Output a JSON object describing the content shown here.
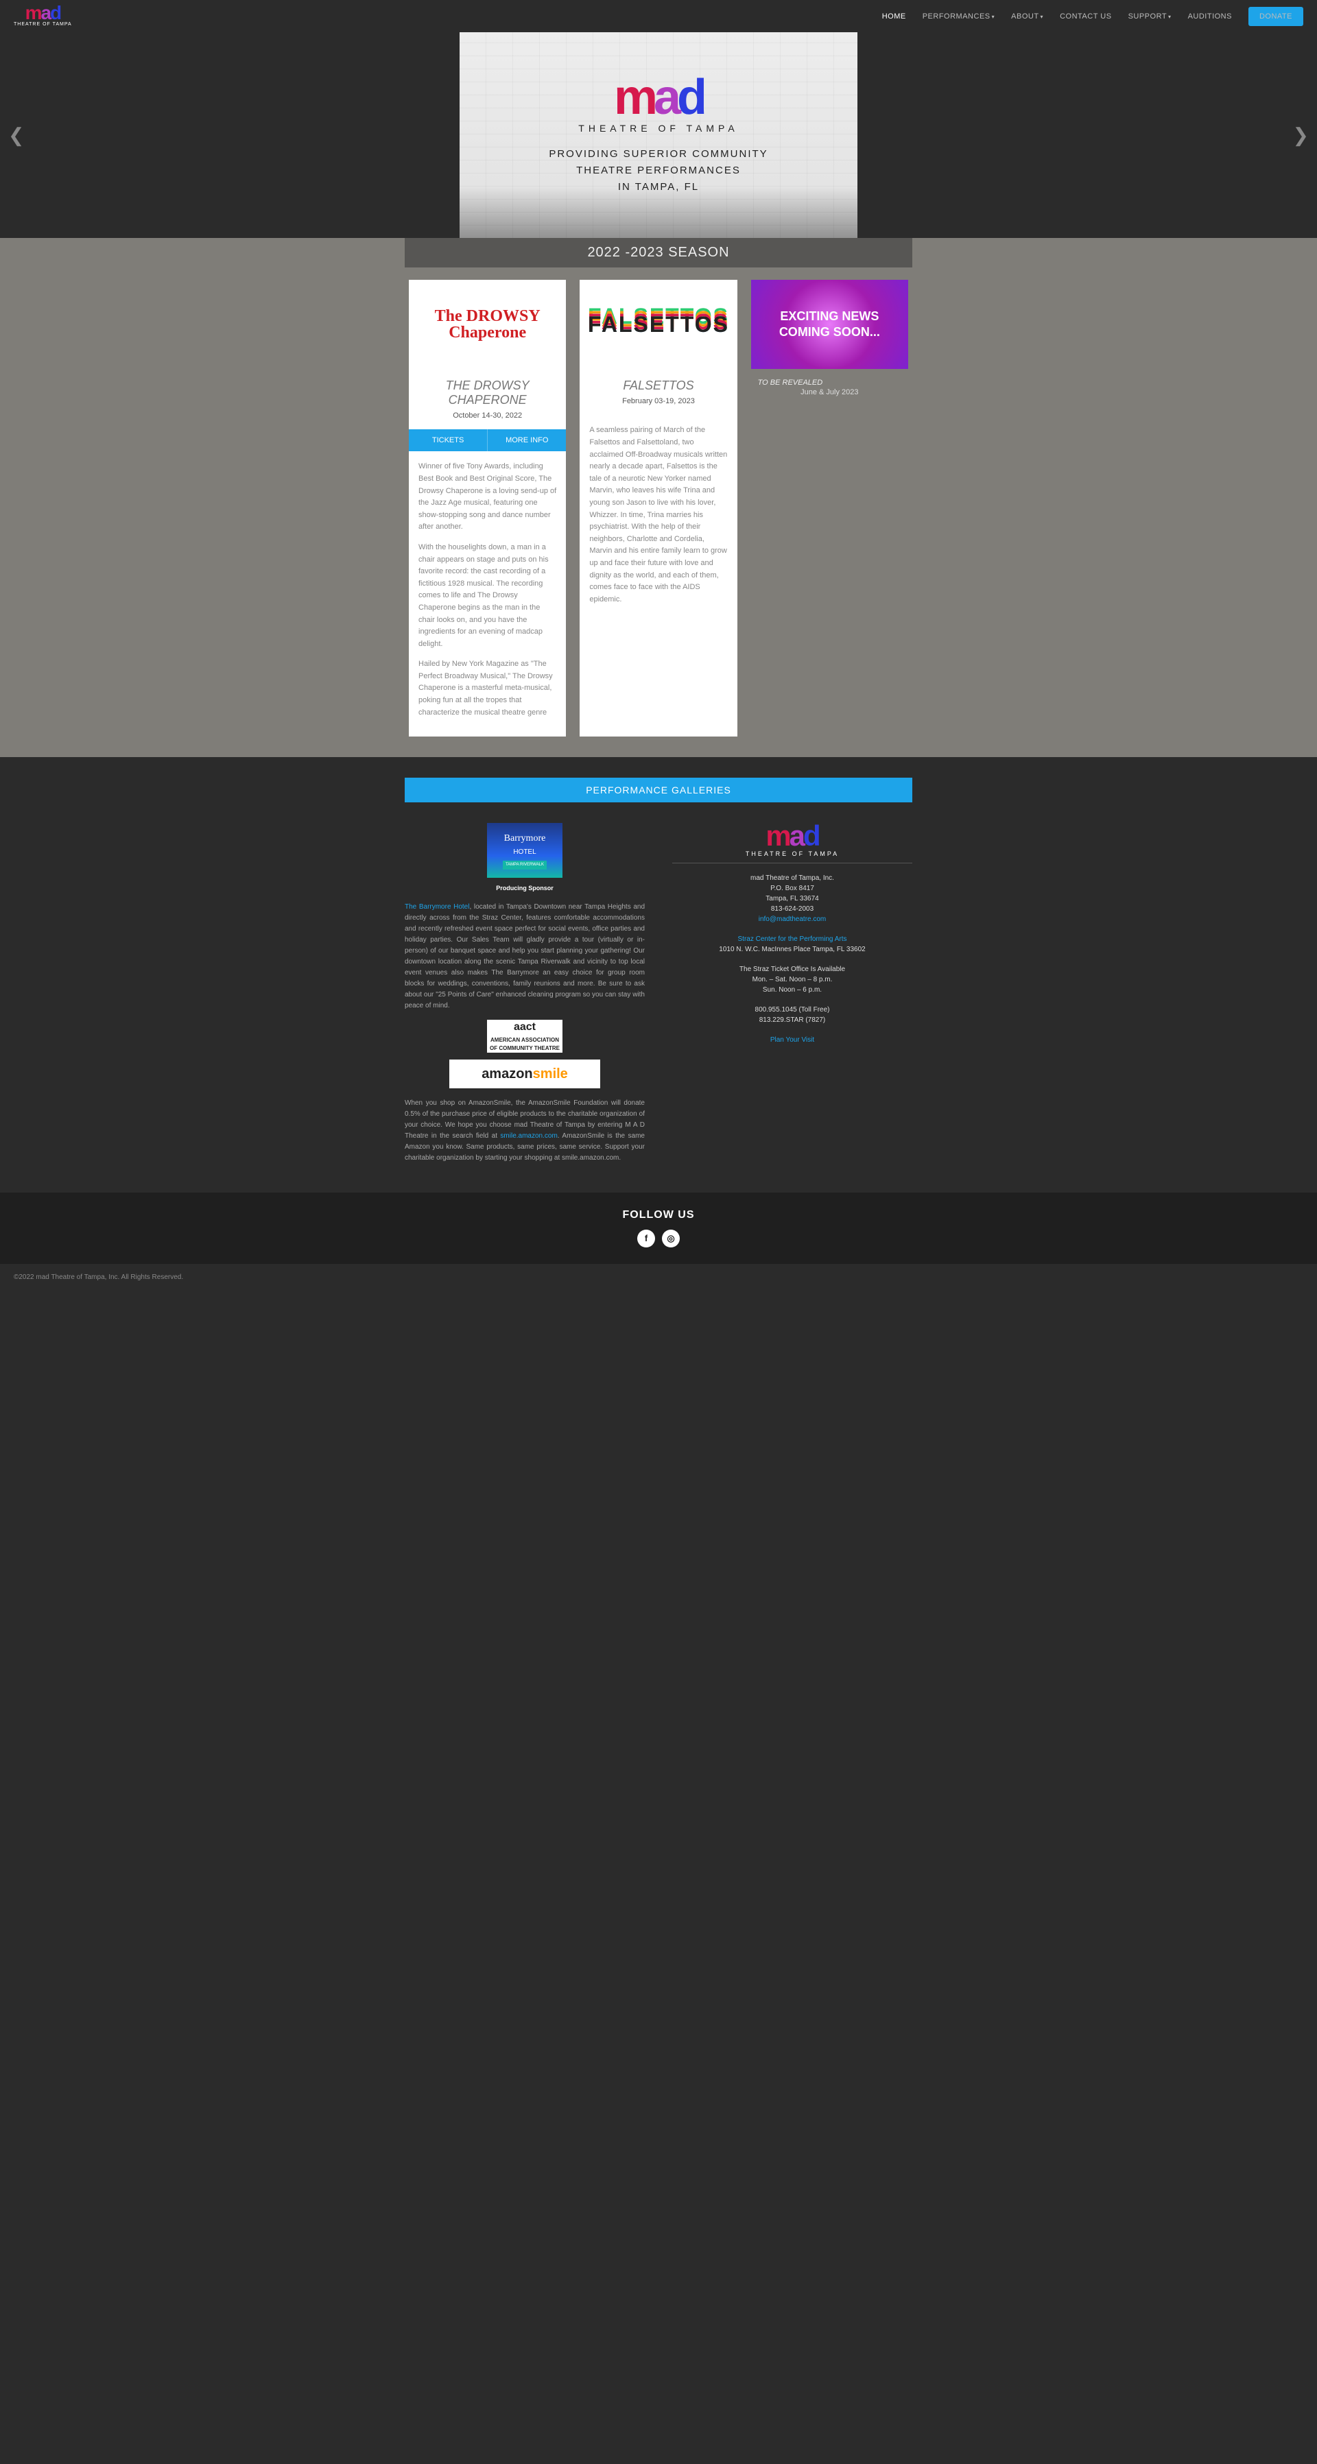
{
  "brand": {
    "name": "mad",
    "sub": "THEATRE OF TAMPA"
  },
  "nav": {
    "home": "HOME",
    "performances": "PERFORMANCES",
    "about": "ABOUT",
    "contact": "CONTACT US",
    "support": "SUPPORT",
    "auditions": "AUDITIONS",
    "donate": "DONATE"
  },
  "hero": {
    "line1": "PROVIDING SUPERIOR COMMUNITY",
    "line2": "THEATRE PERFORMANCES",
    "line3": "IN TAMPA, FL"
  },
  "season": {
    "heading": "2022 -2023 SEASON"
  },
  "show1": {
    "title": "THE DROWSY CHAPERONE",
    "date": "October 14-30, 2022",
    "tickets": "TICKETS",
    "more": "MORE INFO",
    "p1": "Winner of five Tony Awards, including Best Book and Best Original Score, The Drowsy Chaperone is a loving send-up of the Jazz Age musical, featuring one show-stopping song and dance number after another.",
    "p2": "With the houselights down, a man in a chair appears on stage and puts on his favorite record: the cast recording of a fictitious 1928 musical. The recording comes to life and The Drowsy Chaperone begins as the man in the chair looks on, and you have the ingredients for an evening of madcap delight.",
    "p3": "Hailed by New York Magazine as \"The Perfect Broadway Musical,\" The Drowsy Chaperone is a masterful meta-musical, poking fun at all the tropes that characterize the musical theatre genre"
  },
  "show2": {
    "title": "FALSETTOS",
    "date": "February 03-19, 2023",
    "p1": "A seamless pairing of March of the Falsettos and Falsettoland, two acclaimed Off-Broadway musicals written nearly a decade apart, Falsettos is the tale of a neurotic New Yorker named Marvin, who leaves his wife Trina and young son Jason to live with his lover, Whizzer. In time, Trina marries his psychiatrist. With the help of their neighbors, Charlotte and Cordelia, Marvin and his entire family learn to grow up and face their future with love and dignity as the world, and each of them, comes face to face with the AIDS epidemic."
  },
  "show3": {
    "img_text": "EXCITING NEWS COMING SOON...",
    "title": "TO BE REVEALED",
    "date": "June & July 2023"
  },
  "gallery_btn": "PERFORMANCE GALLERIES",
  "sponsor": {
    "img_line1": "Barrymore",
    "img_line2": "HOTEL",
    "img_line3": "TAMPA RIVERWALK",
    "label": "Producing Sponsor",
    "link": "The Barrymore Hotel",
    "text": ", located in Tampa's Downtown near Tampa Heights and directly across from the Straz Center, features comfortable accommodations and recently refreshed event space perfect for social events, office parties and holiday parties. Our Sales Team will gladly provide a tour (virtually or in-person) of our banquet space and help you start planning your gathering! Our downtown location along the scenic Tampa Riverwalk and vicinity to top local event venues also makes The Barrymore an easy choice for group room blocks for weddings, conventions, family reunions and more. Be sure to ask about our \"25 Points of Care\" enhanced cleaning program so you can stay with peace of mind."
  },
  "aact": {
    "line1": "aact",
    "line2": "AMERICAN ASSOCIATION",
    "line3": "OF COMMUNITY THEATRE"
  },
  "amazon": {
    "text1": "When you shop on AmazonSmile, the AmazonSmile Foundation will donate 0.5% of the purchase price of eligible products to the charitable organization of your choice. We hope you choose mad Theatre of Tampa by entering M A D Theatre in the search field at ",
    "link": "smile.amazon.com",
    "text2": ". AmazonSmile is the same Amazon you know. Same products, same prices, same service. Support your charitable organization by starting your shopping at smile.amazon.com."
  },
  "info": {
    "name": "mad Theatre of Tampa, Inc.",
    "po": "P.O. Box 8417",
    "city": "Tampa, FL 33674",
    "phone": "813-624-2003",
    "email": "info@madtheatre.com",
    "straz": "Straz Center for the Performing Arts",
    "straz_addr": "1010 N. W.C. MacInnes Place Tampa, FL 33602",
    "office1": "The Straz Ticket Office Is Available",
    "office2": "Mon. – Sat. Noon – 8 p.m.",
    "office3": "Sun. Noon – 6 p.m.",
    "toll": "800.955.1045 (Toll Free)",
    "star": "813.229.STAR (7827)",
    "plan": "Plan Your Visit"
  },
  "follow": "FOLLOW US",
  "copyright": "©2022 mad Theatre of Tampa, Inc. All Rights Reserved."
}
